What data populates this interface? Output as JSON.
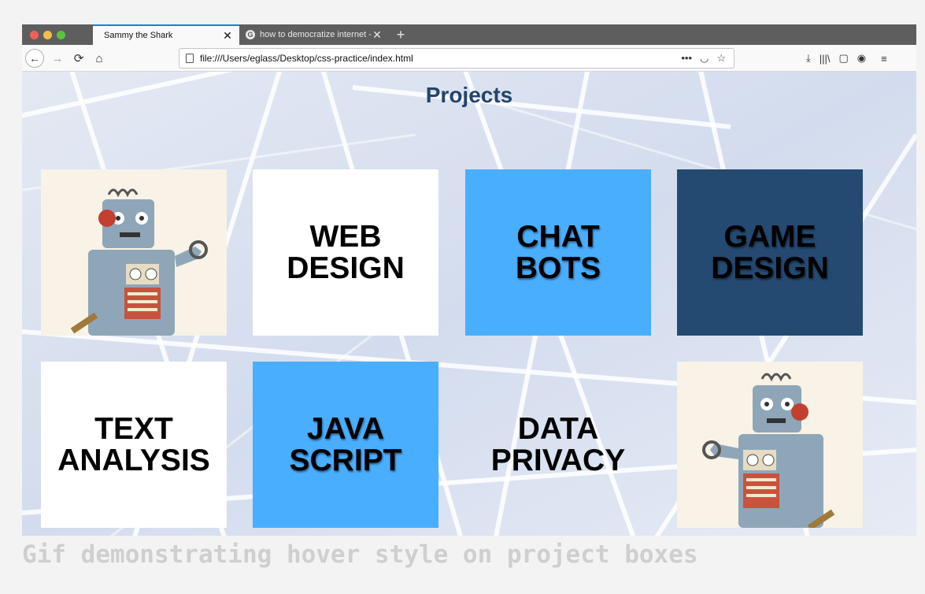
{
  "tabs": [
    {
      "title": "Sammy the Shark",
      "active": true
    },
    {
      "title": "how to democratize internet - ",
      "active": false
    }
  ],
  "new_tab_glyph": "+",
  "nav": {
    "back_glyph": "←",
    "forward_glyph": "→",
    "reload_glyph": "⟳",
    "home_glyph": "⌂"
  },
  "url": "file:///Users/eglass/Desktop/css-practice/index.html",
  "url_actions": {
    "more": "•••",
    "pocket": "◡",
    "bookmark": "☆"
  },
  "toolbar": {
    "download": "⤓",
    "library": "|||\\",
    "sidebar": "▢",
    "account": "◉",
    "menu": "≡"
  },
  "page": {
    "title": "Projects",
    "projects": [
      {
        "label": "",
        "kind": "robot"
      },
      {
        "label": "WEB\nDESIGN",
        "kind": "white"
      },
      {
        "label": "CHAT\nBOTS",
        "kind": "blue"
      },
      {
        "label": "GAME\nDESIGN",
        "kind": "navy"
      },
      {
        "label": "TEXT\nANALYSIS",
        "kind": "white"
      },
      {
        "label": "JAVA\nSCRIPT",
        "kind": "blue"
      },
      {
        "label": "DATA\nPRIVACY",
        "kind": "clear"
      },
      {
        "label": "",
        "kind": "robot"
      }
    ]
  },
  "caption": "Gif demonstrating hover style on project boxes",
  "colors": {
    "title": "#24446b",
    "blue_box": "#4aaeff",
    "navy_box": "#244a72",
    "tab_accent": "#0a84ff"
  }
}
